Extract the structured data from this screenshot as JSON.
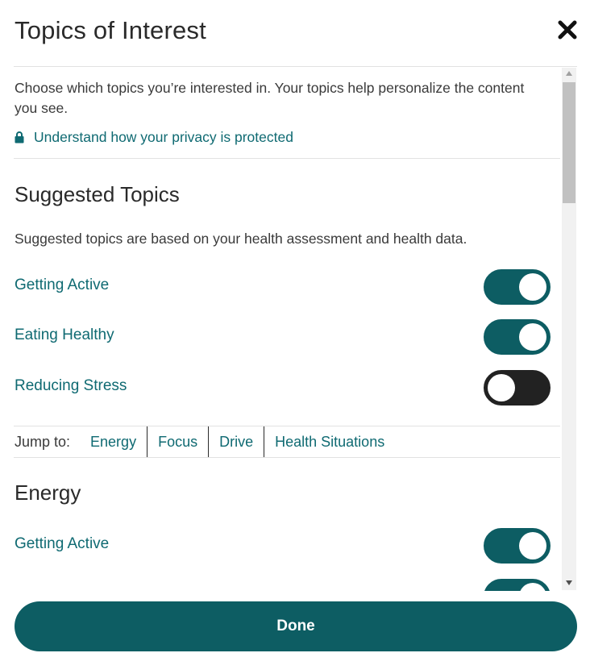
{
  "dialog": {
    "title": "Topics of Interest",
    "close_icon": "close-icon"
  },
  "intro": {
    "text": "Choose which topics you’re interested in. Your topics help personalize the content you see.",
    "privacy_link": "Understand how your privacy is protected",
    "privacy_icon": "lock-icon"
  },
  "suggested": {
    "heading": "Suggested Topics",
    "description": "Suggested topics are based on your health assessment and health data.",
    "topics": [
      {
        "label": "Getting Active",
        "enabled": true
      },
      {
        "label": "Eating Healthy",
        "enabled": true
      },
      {
        "label": "Reducing Stress",
        "enabled": false
      }
    ]
  },
  "jump": {
    "label": "Jump to:",
    "links": [
      "Energy",
      "Focus",
      "Drive",
      "Health Situations"
    ]
  },
  "energy": {
    "heading": "Energy",
    "topics": [
      {
        "label": "Getting Active",
        "enabled": true
      },
      {
        "label": "",
        "enabled": true
      }
    ]
  },
  "footer": {
    "done_label": "Done"
  },
  "colors": {
    "accent": "#0d5d63",
    "link": "#0f6a72",
    "toggle_off": "#222222"
  }
}
